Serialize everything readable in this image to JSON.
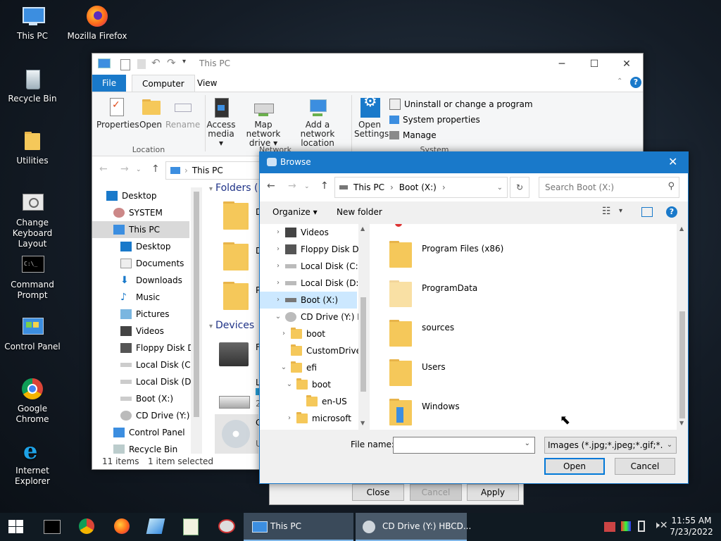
{
  "desktop": {
    "icons": [
      {
        "label": "This PC",
        "icon": "computer-icon"
      },
      {
        "label": "Mozilla Firefox",
        "icon": "firefox-icon"
      },
      {
        "label": "Recycle Bin",
        "icon": "recycle-bin-icon"
      },
      {
        "label": "Utilities",
        "icon": "folder-icon"
      },
      {
        "label": "Change Keyboard Layout",
        "icon": "keyboard-icon"
      },
      {
        "label": "Command Prompt",
        "icon": "cmd-icon"
      },
      {
        "label": "Control Panel",
        "icon": "control-panel-icon"
      },
      {
        "label": "Google Chrome",
        "icon": "chrome-icon"
      },
      {
        "label": "Internet Explorer",
        "icon": "ie-icon"
      }
    ]
  },
  "explorer": {
    "title": "This PC",
    "tabs": {
      "file": "File",
      "computer": "Computer",
      "view": "View"
    },
    "ribbon": {
      "properties": "Properties",
      "open": "Open",
      "rename": "Rename",
      "access_media": "Access media ▾",
      "map_drive": "Map network drive ▾",
      "add_location": "Add a network location",
      "open_settings": "Open Settings",
      "uninstall": "Uninstall or change a program",
      "system_properties": "System properties",
      "manage": "Manage",
      "group_location": "Location",
      "group_network": "Network",
      "group_system": "System"
    },
    "address": "This PC",
    "nav": [
      {
        "label": "Desktop"
      },
      {
        "label": "SYSTEM"
      },
      {
        "label": "This PC"
      },
      {
        "label": "Desktop"
      },
      {
        "label": "Documents"
      },
      {
        "label": "Downloads"
      },
      {
        "label": "Music"
      },
      {
        "label": "Pictures"
      },
      {
        "label": "Videos"
      },
      {
        "label": "Floppy Disk Dri"
      },
      {
        "label": "Local Disk (C:)"
      },
      {
        "label": "Local Disk (D:)"
      },
      {
        "label": "Boot (X:)"
      },
      {
        "label": "CD Drive (Y:) H"
      },
      {
        "label": "Control Panel"
      },
      {
        "label": "Recycle Bin"
      }
    ],
    "sections": {
      "folders": "Folders (",
      "devices": "Devices"
    },
    "status": {
      "items": "11 items",
      "selected": "1 item selected"
    },
    "partial": {
      "d1": "D",
      "d2": "D",
      "p": "P",
      "f": "F",
      "l": "L",
      "two": "2",
      "c": "C",
      "u": "U"
    }
  },
  "behind_dialog": {
    "close": "Close",
    "cancel": "Cancel",
    "apply": "Apply"
  },
  "browse": {
    "title": "Browse",
    "breadcrumb": {
      "root": "This PC",
      "sep1": "›",
      "drive": "Boot (X:)",
      "sep2": "›"
    },
    "search_placeholder": "Search Boot (X:)",
    "organize": "Organize ▾",
    "new_folder": "New folder",
    "tree": [
      {
        "label": "Videos"
      },
      {
        "label": "Floppy Disk Dri"
      },
      {
        "label": "Local Disk (C:)"
      },
      {
        "label": "Local Disk (D:)"
      },
      {
        "label": "Boot (X:)"
      },
      {
        "label": "CD Drive (Y:) H"
      },
      {
        "label": "boot"
      },
      {
        "label": "CustomDrive"
      },
      {
        "label": "efi"
      },
      {
        "label": "boot"
      },
      {
        "label": "en-US"
      },
      {
        "label": "microsoft"
      }
    ],
    "files": [
      {
        "name": "Program Files (x86)"
      },
      {
        "name": "ProgramData"
      },
      {
        "name": "sources"
      },
      {
        "name": "Users"
      },
      {
        "name": "Windows"
      }
    ],
    "file_name_label": "File name:",
    "file_name_value": "",
    "file_type": "Images (*.jpg;*.jpeg;*.gif;*.png;",
    "open": "Open",
    "cancel": "Cancel"
  },
  "taskbar": {
    "tasks": [
      {
        "label": "This PC"
      },
      {
        "label": "CD Drive (Y:) HBCD..."
      }
    ],
    "time": "11:55 AM",
    "date": "7/23/2022"
  },
  "colors": {
    "accent": "#0078d7",
    "selection": "#cce8ff",
    "folder": "#f5c85a"
  }
}
